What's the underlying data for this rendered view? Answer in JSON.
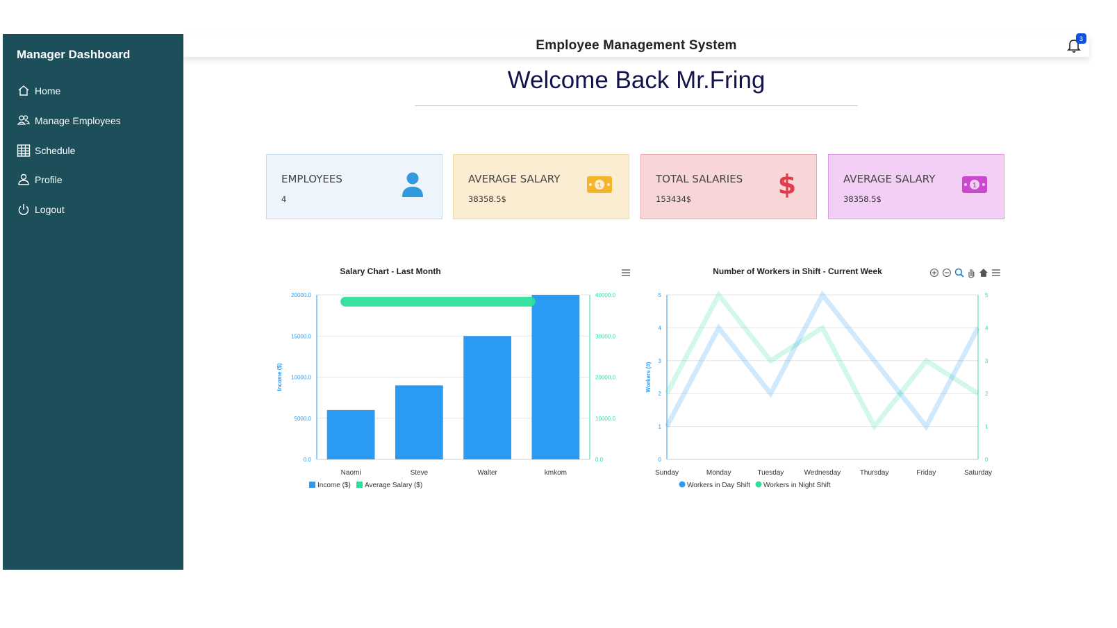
{
  "sidebar": {
    "title": "Manager Dashboard",
    "items": [
      {
        "label": "Home",
        "icon": "home-icon"
      },
      {
        "label": "Manage Employees",
        "icon": "users-icon"
      },
      {
        "label": "Schedule",
        "icon": "table-icon"
      },
      {
        "label": "Profile",
        "icon": "person-icon"
      },
      {
        "label": "Logout",
        "icon": "power-icon"
      }
    ]
  },
  "header": {
    "title": "Employee Management System",
    "notification_count": "3"
  },
  "welcome": "Welcome Back Mr.Fring",
  "cards": [
    {
      "label": "EMPLOYEES",
      "value": "4",
      "icon": "person-icon",
      "bg": "#eef4fb",
      "border": "#c9dbe9",
      "icon_color": "#3399dd"
    },
    {
      "label": "AVERAGE SALARY",
      "value": "38358.5$",
      "icon": "money-icon",
      "bg": "#fbedd2",
      "border": "#f0d9a8",
      "icon_color": "#f3b62a"
    },
    {
      "label": "TOTAL SALARIES",
      "value": "153434$",
      "icon": "dollar-icon",
      "bg": "#f8d6d8",
      "border": "#e7a8ac",
      "icon_color": "#e23a4a"
    },
    {
      "label": "AVERAGE SALARY",
      "value": "38358.5$",
      "icon": "money-icon",
      "bg": "#f3cff5",
      "border": "#d99ade",
      "icon_color": "#c949cf"
    }
  ],
  "chart_data": [
    {
      "type": "bar",
      "title": "Salary Chart - Last Month",
      "categories": [
        "Naomi",
        "Steve",
        "Walter",
        "kmkom"
      ],
      "ylabel": "Income ($)",
      "ylim": [
        0,
        20000
      ],
      "y2lim": [
        0,
        40000
      ],
      "yticks": [
        "0.0",
        "5000.0",
        "10000.0",
        "15000.0",
        "20000.0"
      ],
      "y2ticks": [
        "0.0",
        "10000.0",
        "20000.0",
        "30000.0",
        "40000.0"
      ],
      "series": [
        {
          "name": "Income ($)",
          "values": [
            6000,
            9000,
            15000,
            20000
          ],
          "color": "#2a9af3",
          "axis": "left"
        },
        {
          "name": "Average Salary ($)",
          "values": [
            38358.5,
            38358.5,
            38358.5,
            38358.5
          ],
          "color": "#2ee09a",
          "axis": "right"
        }
      ],
      "legend": "bottom-left",
      "menu_icon": "hamburger-icon"
    },
    {
      "type": "line",
      "title": "Number of Workers in Shift - Current Week",
      "categories": [
        "Sunday",
        "Monday",
        "Tuesday",
        "Wednesday",
        "Thursday",
        "Friday",
        "Saturday"
      ],
      "ylabel": "Workers (#)",
      "ylim": [
        0,
        5
      ],
      "yticks": [
        "0",
        "1",
        "2",
        "3",
        "4",
        "5"
      ],
      "series": [
        {
          "name": "Workers in Day Shift",
          "values": [
            1,
            4,
            2,
            5,
            3,
            1,
            4
          ],
          "color": "#2a9af3"
        },
        {
          "name": "Workers in Night Shift",
          "values": [
            2,
            5,
            3,
            4,
            1,
            3,
            2
          ],
          "color": "#2ee09a"
        }
      ],
      "legend": "bottom-left",
      "toolbar": [
        "zoom-in-icon",
        "zoom-out-icon",
        "magnifier-icon",
        "pan-hand-icon",
        "home-icon",
        "hamburger-icon"
      ]
    }
  ]
}
